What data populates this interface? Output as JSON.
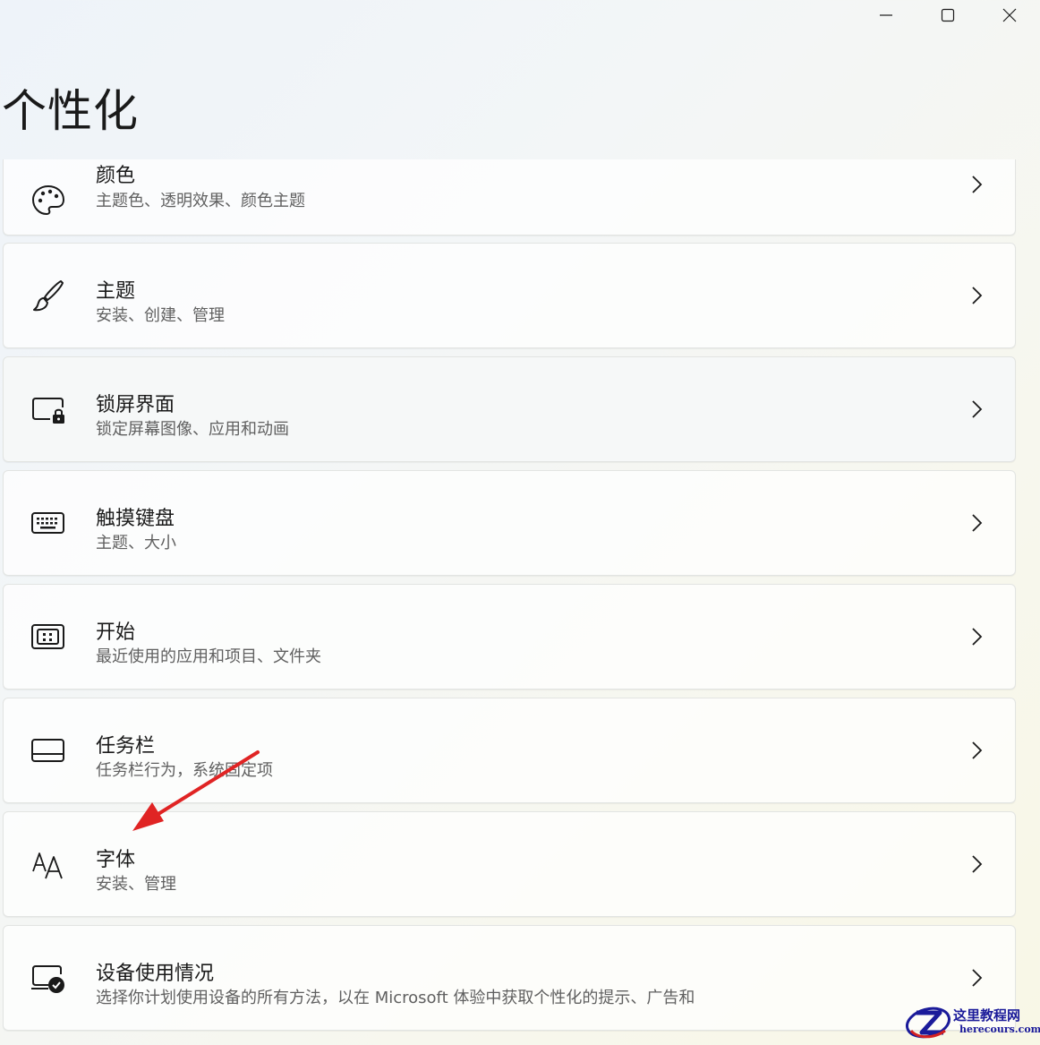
{
  "page": {
    "title": "个性化"
  },
  "window_controls": [
    {
      "name": "minimize",
      "icon": "minimize-icon"
    },
    {
      "name": "maximize",
      "icon": "maximize-icon"
    },
    {
      "name": "close",
      "icon": "close-icon"
    }
  ],
  "settings": [
    {
      "title": "颜色",
      "desc": "主题色、透明效果、颜色主题",
      "icon": "palette-icon"
    },
    {
      "title": "主题",
      "desc": "安装、创建、管理",
      "icon": "brush-icon"
    },
    {
      "title": "锁屏界面",
      "desc": "锁定屏幕图像、应用和动画",
      "icon": "lock-screen-icon"
    },
    {
      "title": "触摸键盘",
      "desc": "主题、大小",
      "icon": "keyboard-icon"
    },
    {
      "title": "开始",
      "desc": "最近使用的应用和项目、文件夹",
      "icon": "start-icon"
    },
    {
      "title": "任务栏",
      "desc": "任务栏行为，系统固定项",
      "icon": "taskbar-icon"
    },
    {
      "title": "字体",
      "desc": "安装、管理",
      "icon": "font-icon"
    },
    {
      "title": "设备使用情况",
      "desc": "选择你计划使用设备的所有方法，以在 Microsoft 体验中获取个性化的提示、广告和",
      "icon": "device-usage-icon"
    }
  ],
  "annotation": {
    "color": "#e02424"
  },
  "watermark": {
    "title": "这里教程网",
    "url": "herecours.com"
  }
}
